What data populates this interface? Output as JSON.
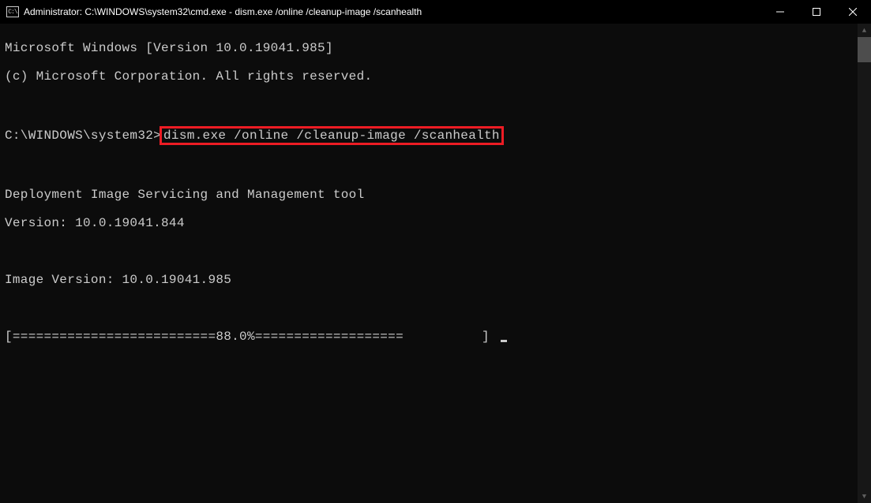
{
  "titlebar": {
    "icon_label": "C:\\",
    "text": "Administrator: C:\\WINDOWS\\system32\\cmd.exe - dism.exe  /online /cleanup-image /scanhealth"
  },
  "terminal": {
    "line1": "Microsoft Windows [Version 10.0.19041.985]",
    "line2": "(c) Microsoft Corporation. All rights reserved.",
    "prompt_prefix": "C:\\WINDOWS\\system32>",
    "highlighted_command": "dism.exe /online /cleanup-image /scanhealth",
    "tool_line1": "Deployment Image Servicing and Management tool",
    "tool_line2": "Version: 10.0.19041.844",
    "image_version": "Image Version: 10.0.19041.985",
    "progress": "[==========================88.0%===================          ] "
  }
}
